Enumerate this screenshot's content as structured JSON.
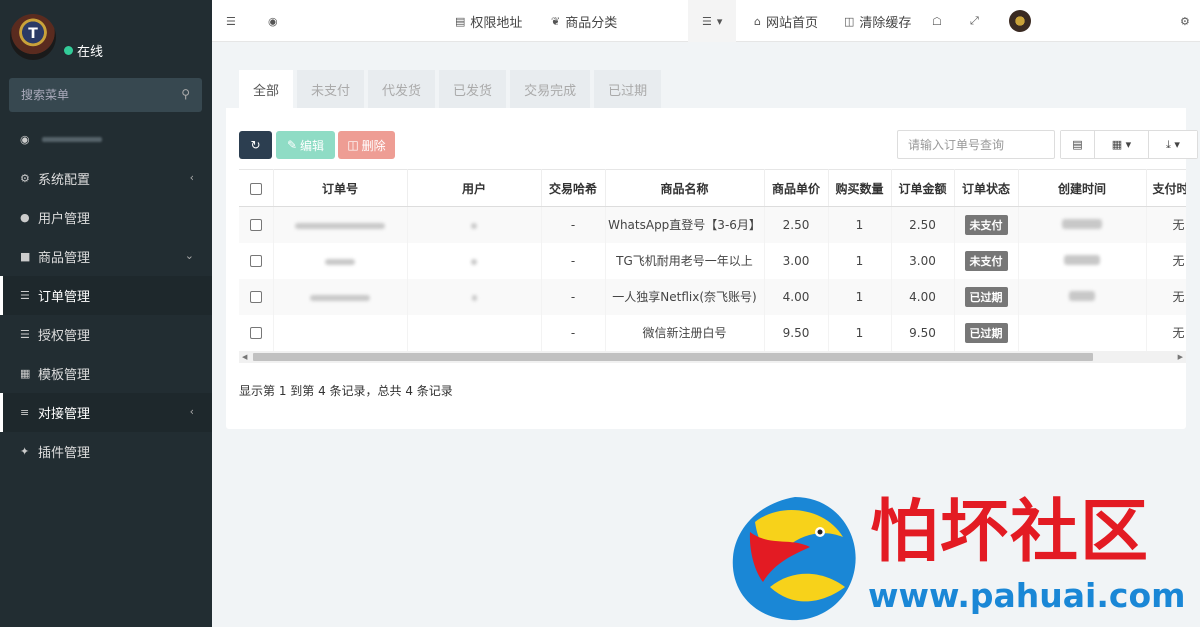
{
  "sidebar": {
    "status": "在线",
    "search_placeholder": "搜索菜单",
    "items": [
      {
        "label": "系统配置"
      },
      {
        "label": "用户管理"
      },
      {
        "label": "商品管理"
      },
      {
        "label": "订单管理"
      },
      {
        "label": "授权管理"
      },
      {
        "label": "模板管理"
      },
      {
        "label": "对接管理"
      },
      {
        "label": "插件管理"
      }
    ]
  },
  "topnav": {
    "permission": "权限地址",
    "category": "商品分类",
    "home": "网站首页",
    "clear_cache": "清除缓存"
  },
  "tabs": [
    "全部",
    "未支付",
    "代发货",
    "已发货",
    "交易完成",
    "已过期"
  ],
  "toolbar": {
    "edit": "编辑",
    "delete": "删除",
    "search_placeholder": "请输入订单号查询"
  },
  "table": {
    "headers": [
      "订单号",
      "用户",
      "交易哈希",
      "商品名称",
      "商品单价",
      "购买数量",
      "订单金额",
      "订单状态",
      "创建时间",
      "支付时"
    ],
    "rows": [
      {
        "hash": "-",
        "product": "WhatsApp直登号【3-6月】",
        "price": "2.50",
        "qty": "1",
        "amount": "2.50",
        "status": "未支付",
        "pay": "无"
      },
      {
        "hash": "-",
        "product": "TG飞机耐用老号一年以上",
        "price": "3.00",
        "qty": "1",
        "amount": "3.00",
        "status": "未支付",
        "pay": "无"
      },
      {
        "hash": "-",
        "product": "一人独享Netflix(奈飞账号)",
        "price": "4.00",
        "qty": "1",
        "amount": "4.00",
        "status": "已过期",
        "pay": "无"
      },
      {
        "hash": "-",
        "product": "微信新注册白号",
        "price": "9.50",
        "qty": "1",
        "amount": "9.50",
        "status": "已过期",
        "pay": "无"
      }
    ]
  },
  "summary": "显示第 1 到第 4 条记录，总共 4 条记录",
  "watermark": {
    "title": "怕坏社区",
    "url": "www.pahuai.com"
  },
  "colors": {
    "sidebar_bg": "#222d32",
    "edit_btn": "#8fdcc5",
    "delete_btn": "#ee9d94",
    "badge": "#777777",
    "watermark_red": "#e31b23",
    "watermark_blue": "#1a87d6"
  }
}
